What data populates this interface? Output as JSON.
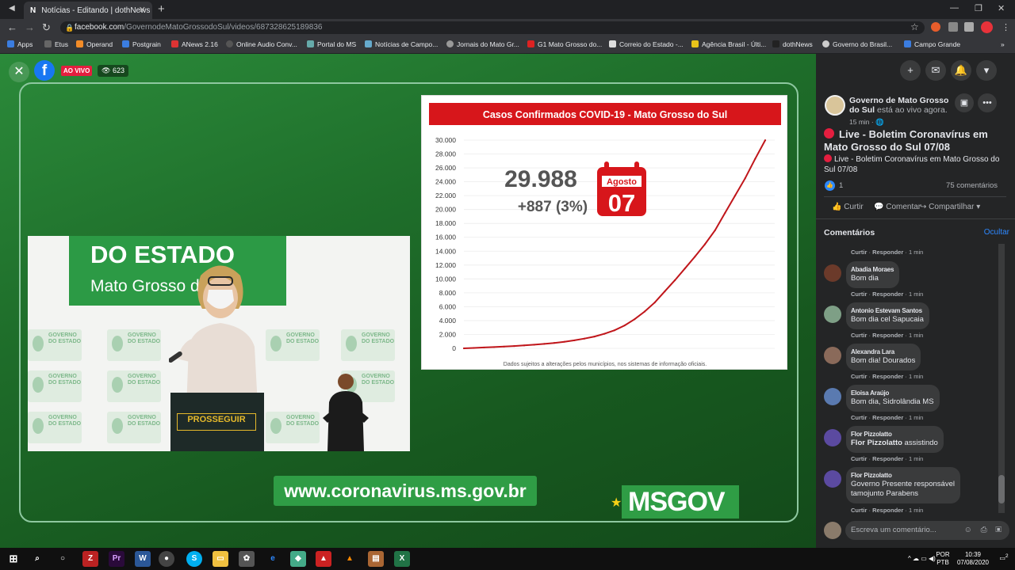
{
  "browser": {
    "tab_title": "Notícias - Editando | dothNews",
    "tab_favicon": "N",
    "url_host": "facebook.com",
    "url_path": "/GovernodeMatoGrossodoSul/videos/687328625189836",
    "bookmarks": [
      "Apps",
      "Etus",
      "Operand",
      "Postgrain",
      "ANews 2.16",
      "Online Audio Conv...",
      "Portal do MS",
      "Notícias de Campo...",
      "Jornais do Mato Gr...",
      "G1 Mato Grosso do...",
      "Correio do Estado -...",
      "Agência Brasil - Últi...",
      "dothNews",
      "Governo do Brasil...",
      "Campo Grande"
    ]
  },
  "video": {
    "live_badge": "AO VIVO",
    "viewers": "623",
    "banner_line1": "DO ESTADO",
    "banner_line2": "Mato Grosso do Sul",
    "tile_text_1": "GOVERNO",
    "tile_text_2": "DO ESTADO",
    "podium_sign": "PROSSEGUIR",
    "website": "www.coronavirus.ms.gov.br",
    "logo": "MSGOV"
  },
  "chart_data": {
    "type": "line",
    "title": "Casos Confirmados COVID-19 - Mato Grosso do Sul",
    "ylim": [
      0,
      30000
    ],
    "yticks": [
      "0",
      "2.000",
      "4.000",
      "6.000",
      "8.000",
      "10.000",
      "12.000",
      "14.000",
      "16.000",
      "18.000",
      "20.000",
      "22.000",
      "24.000",
      "26.000",
      "28.000",
      "30.000"
    ],
    "y_tick_values": [
      0,
      2000,
      4000,
      6000,
      8000,
      10000,
      12000,
      14000,
      16000,
      18000,
      20000,
      22000,
      24000,
      26000,
      28000,
      30000
    ],
    "series": [
      {
        "values": [
          0,
          60,
          120,
          180,
          250,
          330,
          420,
          520,
          640,
          780,
          950,
          1150,
          1400,
          1700,
          2100,
          2600,
          3300,
          4200,
          5300,
          6600,
          8200,
          9800,
          11500,
          13200,
          15000,
          17000,
          19500,
          22000,
          24500,
          27300,
          29988
        ]
      }
    ],
    "total": "29.988",
    "increase": "+887 (3%)",
    "calendar_month": "Agosto",
    "calendar_day": "07",
    "footnote": "Dados sujeitos a alterações pelos municípios, nos sistemas de informação oficiais.",
    "colors": {
      "header": "#d7161b",
      "line": "#c0161b",
      "text": "#555555"
    }
  },
  "panel": {
    "page_name": "Governo de Mato Grosso do Sul",
    "page_status": "está ao vivo agora.",
    "time": "15 min · ",
    "post_title": "Live - Boletim Coronavírus em Mato Grosso do Sul 07/08",
    "post_desc": "Live - Boletim Coronavírus em Mato Grosso do Sul 07/08",
    "likes": "1",
    "comments_count": "75 comentários",
    "actions": {
      "like": "Curtir",
      "comment": "Comentar",
      "share": "Compartilhar"
    },
    "comments_label": "Comentários",
    "hide": "Ocultar",
    "comment_meta": {
      "like": "Curtir",
      "reply": "Responder",
      "time": "1 min"
    },
    "comments": [
      {
        "name": "Abadia Moraes",
        "text": "Bom dia"
      },
      {
        "name": "Antonio Estevam Santos",
        "text": "Bom dia cel Sapucaia"
      },
      {
        "name": "Alexandra Lara",
        "text": "Bom dia! Dourados"
      },
      {
        "name": "Eloisa Araújo",
        "text": "Bom dia, Sidrolândia MS"
      },
      {
        "name": "Flor Pizzolatto",
        "text": "Flor Pizzolatto assistindo",
        "text_bold": "Flor Pizzolatto",
        "text_rest": " assistindo"
      },
      {
        "name": "Flor Pizzolatto",
        "text": "Governo Presente responsável tamojunto Parabens",
        "line1": "Governo Presente responsável",
        "line2": "tamojunto Parabens"
      }
    ],
    "compose_placeholder": "Escreva um comentário..."
  },
  "taskbar": {
    "lang": "POR",
    "layout": "PTB",
    "time": "10:39",
    "date": "07/08/2020",
    "notifications": "2"
  }
}
